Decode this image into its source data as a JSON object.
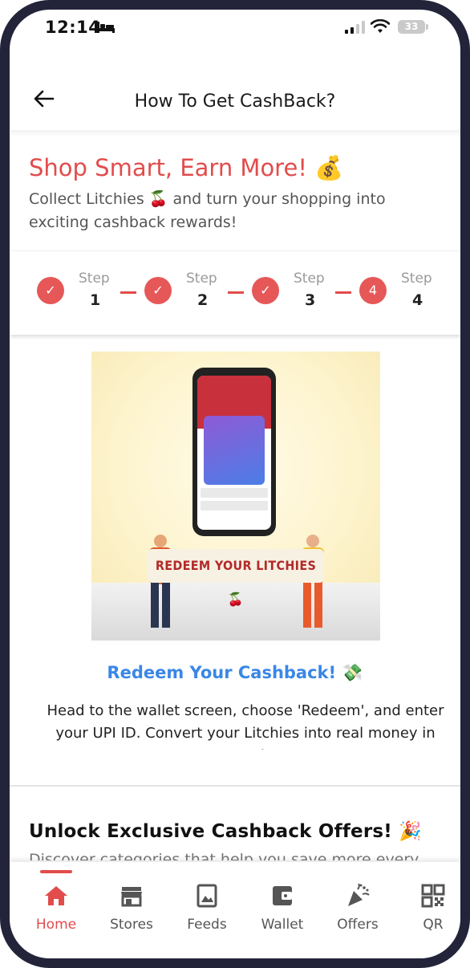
{
  "status_bar": {
    "time": "12:14",
    "battery": "33"
  },
  "header": {
    "title": "How To Get CashBack?"
  },
  "intro": {
    "title": "Shop Smart, Earn More! 💰",
    "text": "Collect Litchies 🍒 and turn your shopping into exciting cashback rewards!"
  },
  "stepper": {
    "steps": [
      {
        "label": "Step",
        "number": "1",
        "state": "done",
        "marker": "✓"
      },
      {
        "label": "Step",
        "number": "2",
        "state": "done",
        "marker": "✓"
      },
      {
        "label": "Step",
        "number": "3",
        "state": "done",
        "marker": "✓"
      },
      {
        "label": "Step",
        "number": "4",
        "state": "current",
        "marker": "4"
      }
    ]
  },
  "illustration": {
    "banner_text": "REDEEM YOUR LITCHIES 🍒"
  },
  "redeem": {
    "title": "Redeem Your Cashback! 💸",
    "text": "Head to the wallet screen, choose 'Redeem', and enter your UPI ID. Convert your Litchies into real money in seconds!"
  },
  "unlock": {
    "title": "Unlock Exclusive Cashback Offers! 🎉",
    "text": "Discover categories that help you save more every"
  },
  "bottom_nav": {
    "items": [
      {
        "label": "Home",
        "icon": "home-icon",
        "active": true
      },
      {
        "label": "Stores",
        "icon": "store-icon",
        "active": false
      },
      {
        "label": "Feeds",
        "icon": "image-icon",
        "active": false
      },
      {
        "label": "Wallet",
        "icon": "wallet-icon",
        "active": false
      },
      {
        "label": "Offers",
        "icon": "party-popper-icon",
        "active": false
      },
      {
        "label": "QR",
        "icon": "qr-code-icon",
        "active": false
      }
    ]
  },
  "colors": {
    "accent": "#e24c4c",
    "link_blue": "#3a87e6",
    "frame": "#23243a"
  }
}
